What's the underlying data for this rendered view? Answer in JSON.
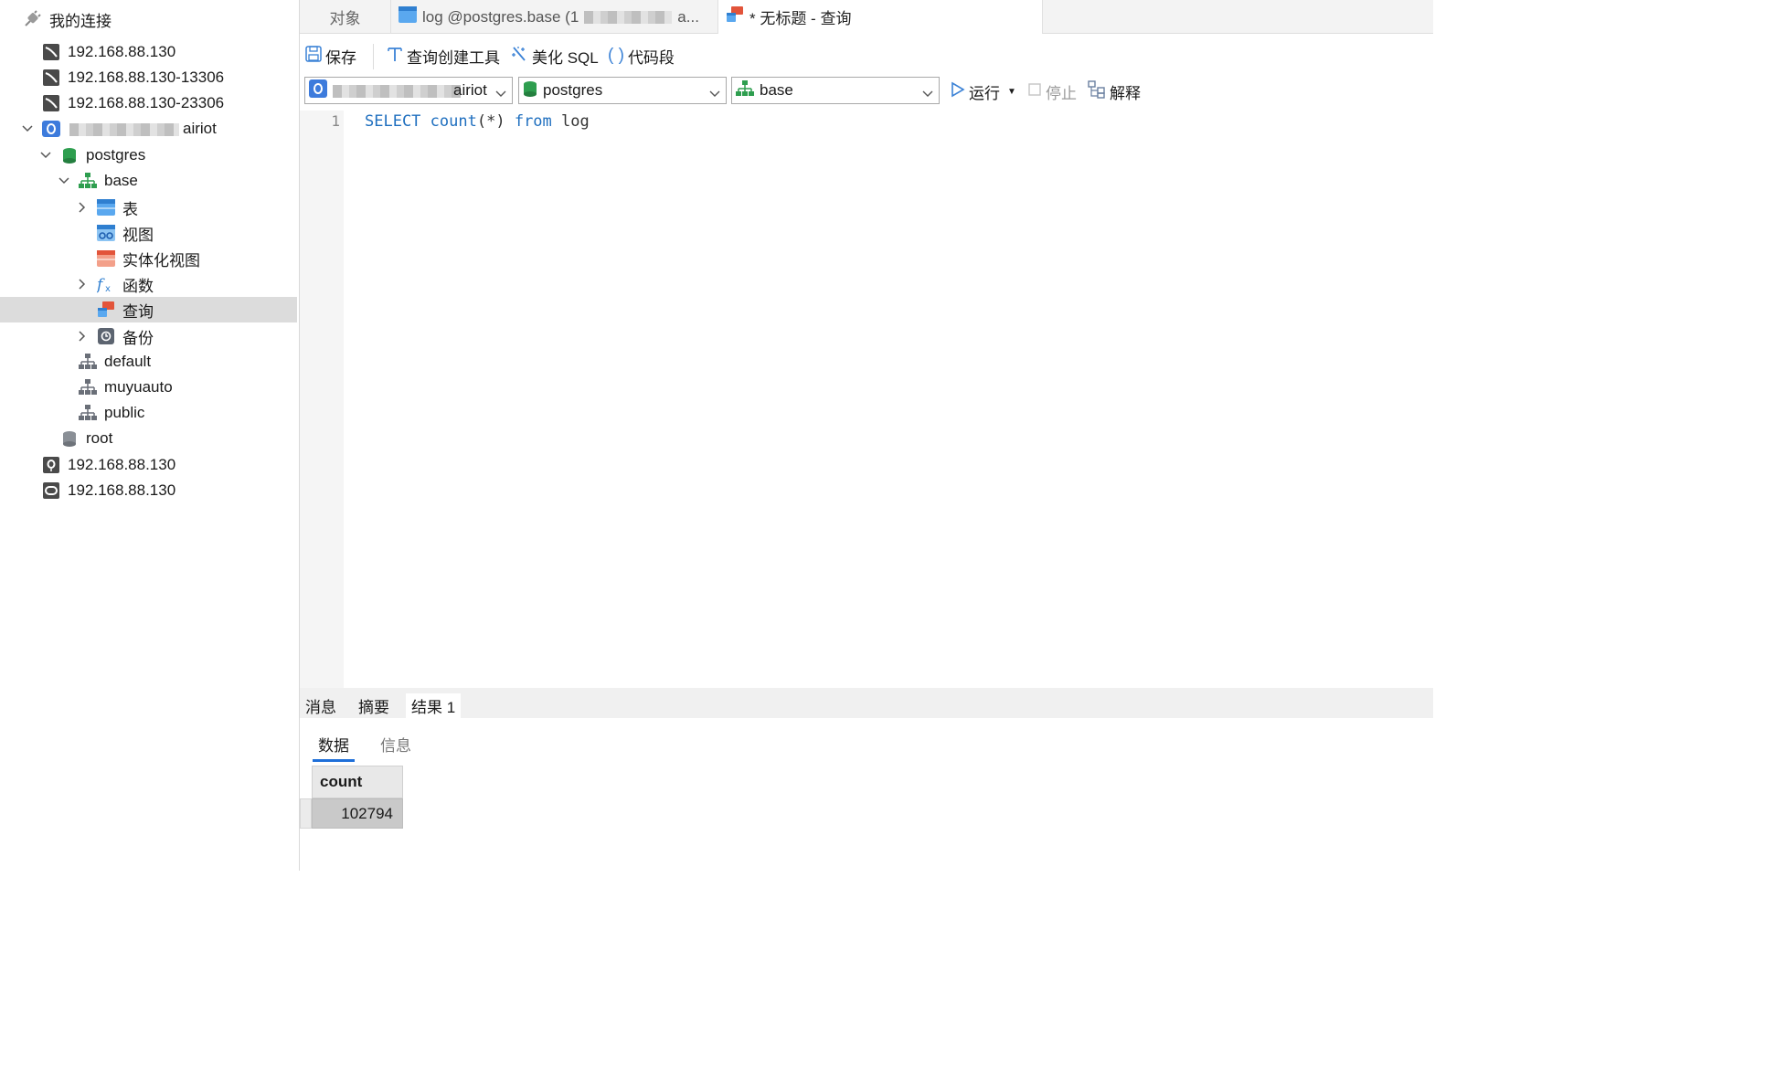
{
  "sidebar": {
    "header": "我的连接",
    "items": [
      {
        "label": "192.168.88.130",
        "icon": "mysql-connection-icon"
      },
      {
        "label": "192.168.88.130-13306",
        "icon": "mysql-connection-icon"
      },
      {
        "label": "192.168.88.130-23306",
        "icon": "mysql-connection-icon"
      },
      {
        "label": "airiot",
        "icon": "postgres-connection-icon"
      },
      {
        "label": "postgres",
        "icon": "database-icon"
      },
      {
        "label": "base",
        "icon": "schema-icon"
      },
      {
        "label": "表",
        "icon": "table-icon"
      },
      {
        "label": "视图",
        "icon": "view-icon"
      },
      {
        "label": "实体化视图",
        "icon": "materialized-view-icon"
      },
      {
        "label": "函数",
        "icon": "function-icon"
      },
      {
        "label": "查询",
        "icon": "query-icon"
      },
      {
        "label": "备份",
        "icon": "backup-icon"
      },
      {
        "label": "default",
        "icon": "schema-icon"
      },
      {
        "label": "muyuauto",
        "icon": "schema-icon"
      },
      {
        "label": "public",
        "icon": "schema-icon"
      },
      {
        "label": "root",
        "icon": "database-icon"
      },
      {
        "label": "192.168.88.130",
        "icon": "postgres-connection-icon"
      },
      {
        "label": "192.168.88.130",
        "icon": "redis-connection-icon"
      }
    ]
  },
  "tabs": {
    "objects": "对象",
    "log_tab": "log @postgres.base (1",
    "log_tab_tail": "a...",
    "active_tab": "* 无标题 - 查询"
  },
  "toolbar": {
    "save": "保存",
    "query_builder": "查询创建工具",
    "beautify": "美化 SQL",
    "snippet": "代码段"
  },
  "selectors": {
    "connection": "airiot",
    "database": "postgres",
    "schema": "base"
  },
  "actions": {
    "run": "运行",
    "stop": "停止",
    "explain": "解释"
  },
  "editor": {
    "line_number": "1",
    "kw_select": "SELECT",
    "fn_count": "count",
    "args": "(*)",
    "kw_from": "from",
    "table": "log"
  },
  "result_tabs": {
    "messages": "消息",
    "summary": "摘要",
    "result1": "结果 1"
  },
  "sub_tabs": {
    "data": "数据",
    "info": "信息"
  },
  "grid": {
    "column": "count",
    "value": "102794"
  },
  "colors": {
    "accent": "#1e6fd9",
    "keyword": "#1f6fbf",
    "selected_row": "#dcdcdc"
  }
}
